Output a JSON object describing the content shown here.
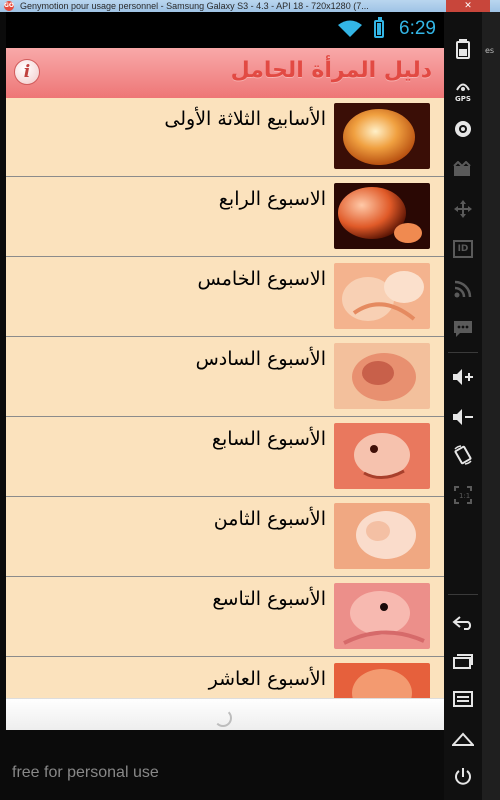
{
  "window": {
    "title": "Genymotion pour usage personnel - Samsung Galaxy S3 - 4.3 - API 18 - 720x1280 (7...",
    "logo": "GO",
    "close_label": "✕",
    "edge_text": "es"
  },
  "status_bar": {
    "time": "6:29",
    "accent": "#33b5e5"
  },
  "app_bar": {
    "title": "دليل المرأة الحامل",
    "info_icon": "i"
  },
  "list": {
    "items": [
      {
        "label": "الأسابيع الثلاثة الأولى",
        "thumb": "embryo-egg"
      },
      {
        "label": "الاسبوع الرابع",
        "thumb": "embryo-week4"
      },
      {
        "label": "الاسبوع الخامس",
        "thumb": "embryo-week5"
      },
      {
        "label": "الأسبوع السادس",
        "thumb": "embryo-week6"
      },
      {
        "label": "الأسبوع السابع",
        "thumb": "embryo-week7"
      },
      {
        "label": "الأسبوع الثامن",
        "thumb": "embryo-week8"
      },
      {
        "label": "الأسبوع التاسع",
        "thumb": "embryo-week9"
      },
      {
        "label": "الأسبوع العاشر",
        "thumb": "embryo-week10"
      }
    ]
  },
  "watermark": "free for personal use",
  "sidebar": {
    "buttons": [
      "battery-icon",
      "gps-icon",
      "camera-icon",
      "video-icon",
      "move-icon",
      "id-icon",
      "rss-icon",
      "sms-icon",
      "volume-up-icon",
      "volume-down-icon",
      "rotate-icon",
      "scale-icon",
      "back-icon",
      "recent-apps-icon",
      "menu-icon",
      "home-icon",
      "power-icon"
    ],
    "gps_label": "GPS",
    "id_label": "ID"
  },
  "colors": {
    "app_bar": "#ee7676",
    "title": "#e24a43",
    "row_bg": "#fbe2bd"
  }
}
